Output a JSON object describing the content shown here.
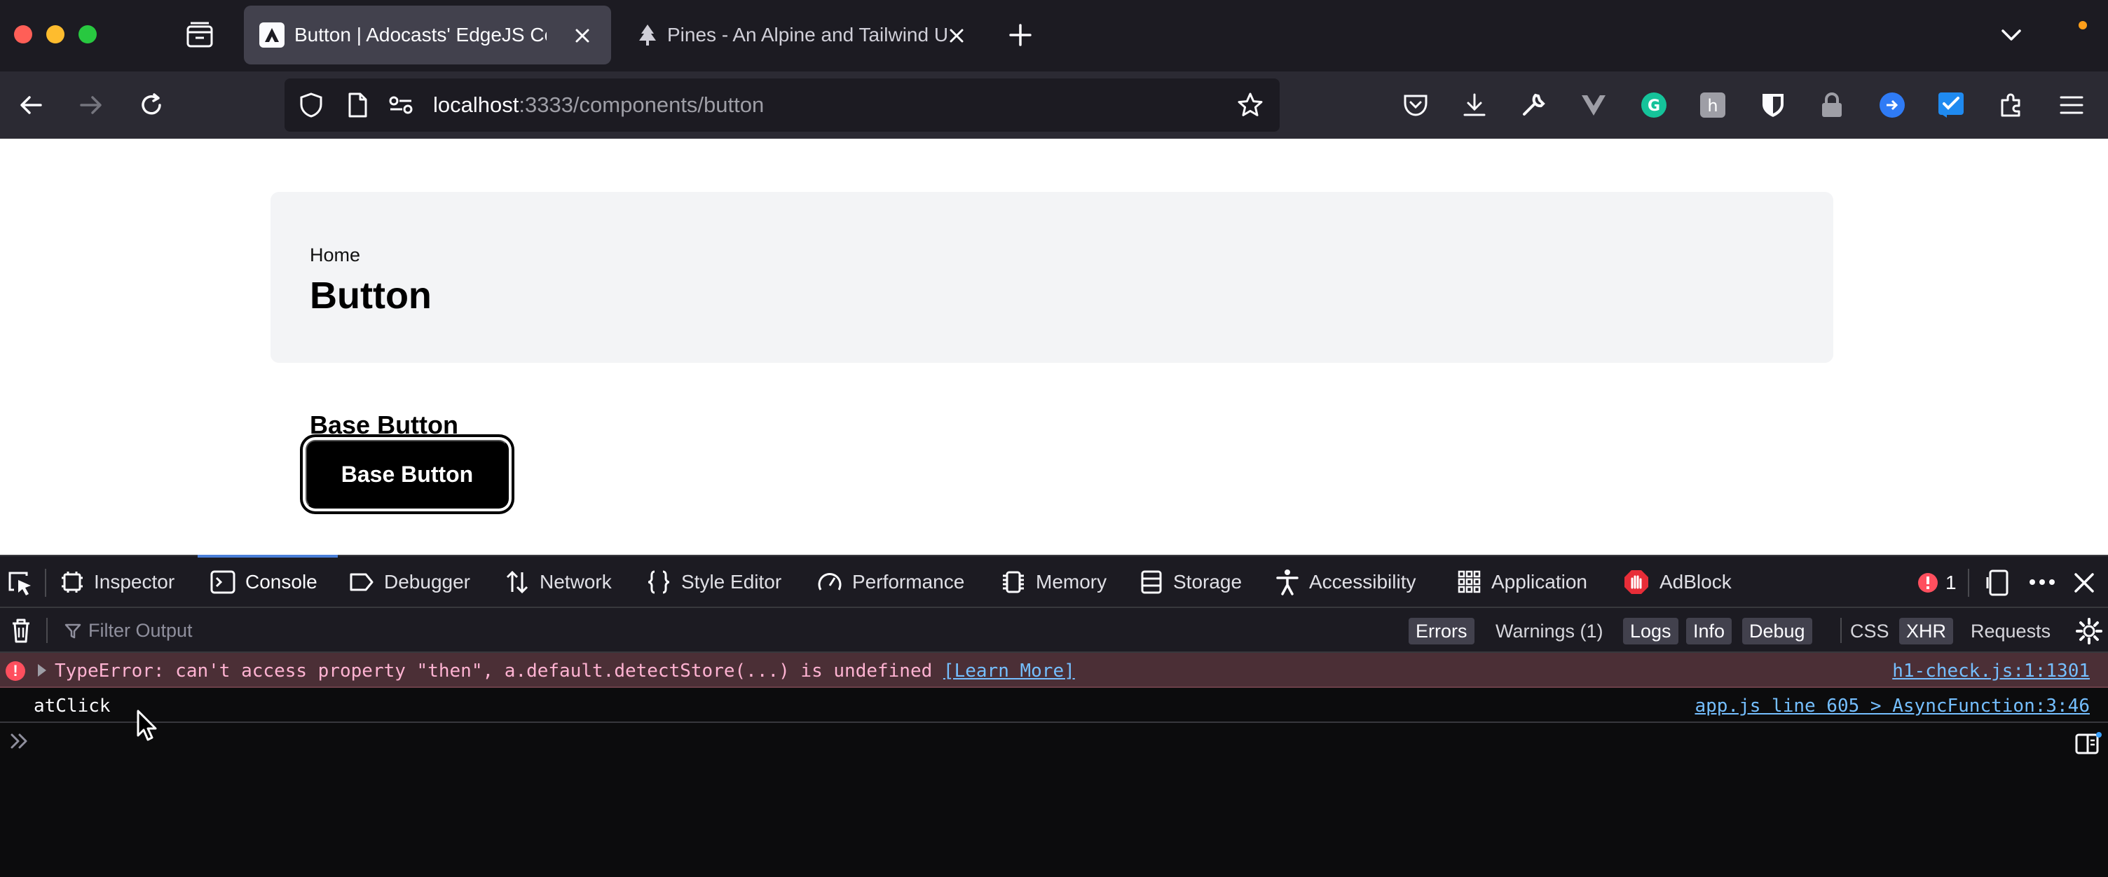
{
  "browser": {
    "tabs": [
      {
        "title": "Button | Adocasts' EdgeJS Com",
        "active": true
      },
      {
        "title": "Pines - An Alpine and Tailwind U",
        "active": false
      }
    ],
    "url_host": "localhost",
    "url_path": ":3333/components/button",
    "extensions": [
      "pocket-icon",
      "download-icon",
      "wrench-icon",
      "vue-devtools-icon",
      "grammarly-icon",
      "honey-icon",
      "bitwarden-icon",
      "lock-icon",
      "extension-blue-icon",
      "extension-cyan-icon",
      "extensions-puzzle-icon",
      "menu-icon"
    ]
  },
  "page": {
    "breadcrumb": "Home",
    "title": "Button",
    "section_title": "Base Button",
    "button_label": "Base Button"
  },
  "devtools": {
    "tabs": [
      {
        "label": "Inspector",
        "icon": "inspector-icon"
      },
      {
        "label": "Console",
        "icon": "console-icon",
        "active": true
      },
      {
        "label": "Debugger",
        "icon": "debugger-icon"
      },
      {
        "label": "Network",
        "icon": "network-icon"
      },
      {
        "label": "Style Editor",
        "icon": "braces-icon"
      },
      {
        "label": "Performance",
        "icon": "gauge-icon"
      },
      {
        "label": "Memory",
        "icon": "chip-icon"
      },
      {
        "label": "Storage",
        "icon": "storage-icon"
      },
      {
        "label": "Accessibility",
        "icon": "accessibility-icon"
      },
      {
        "label": "Application",
        "icon": "grid-icon"
      },
      {
        "label": "AdBlock",
        "icon": "adblock-icon"
      }
    ],
    "error_count": "1",
    "filter_placeholder": "Filter Output",
    "filters": {
      "errors": "Errors",
      "warnings": "Warnings (1)",
      "logs": "Logs",
      "info": "Info",
      "debug": "Debug",
      "css": "CSS",
      "xhr": "XHR",
      "requests": "Requests"
    },
    "messages": {
      "error_text": "TypeError: can't access property \"then\", a.default.detectStore(...) is undefined",
      "error_link": "[Learn More]",
      "error_source": "h1-check.js:1:1301",
      "log_text": "atClick",
      "log_source": "app.js line 605 > AsyncFunction:3:46"
    }
  },
  "colors": {
    "tab_strip": "#1c1b22",
    "toolbar": "#2b2a33",
    "accent": "#4a7fd8",
    "error_bg": "#4b2f36",
    "link": "#75bfff"
  }
}
